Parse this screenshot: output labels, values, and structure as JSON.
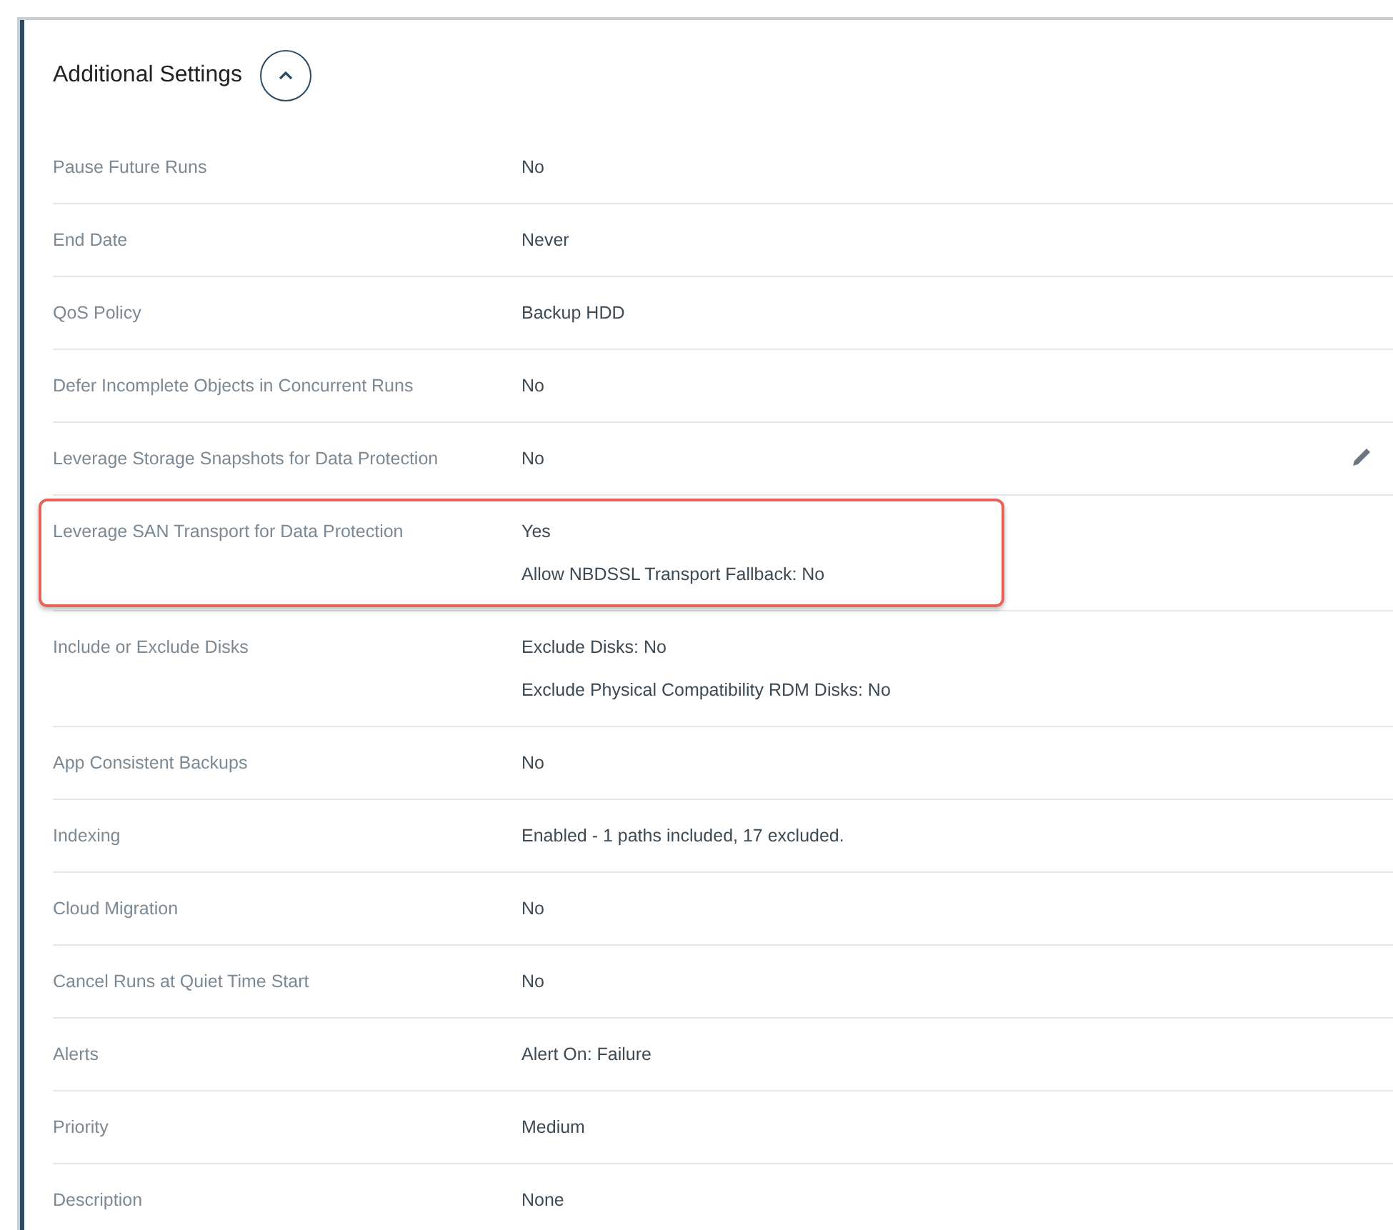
{
  "section": {
    "title": "Additional Settings",
    "expanded": true
  },
  "rows": [
    {
      "label": "Pause Future Runs",
      "values": [
        "No"
      ],
      "highlighted": false,
      "editable": false
    },
    {
      "label": "End Date",
      "values": [
        "Never"
      ],
      "highlighted": false,
      "editable": false
    },
    {
      "label": "QoS Policy",
      "values": [
        "Backup HDD"
      ],
      "highlighted": false,
      "editable": false
    },
    {
      "label": "Defer Incomplete Objects in Concurrent Runs",
      "values": [
        "No"
      ],
      "highlighted": false,
      "editable": false
    },
    {
      "label": "Leverage Storage Snapshots for Data Protection",
      "values": [
        "No"
      ],
      "highlighted": false,
      "editable": true
    },
    {
      "label": "Leverage SAN Transport for Data Protection",
      "values": [
        "Yes",
        "Allow NBDSSL Transport Fallback: No"
      ],
      "highlighted": true,
      "editable": false
    },
    {
      "label": "Include or Exclude Disks",
      "values": [
        "Exclude Disks: No",
        "Exclude Physical Compatibility RDM Disks: No"
      ],
      "highlighted": false,
      "editable": false
    },
    {
      "label": "App Consistent Backups",
      "values": [
        "No"
      ],
      "highlighted": false,
      "editable": false
    },
    {
      "label": "Indexing",
      "values": [
        "Enabled - 1 paths included, 17 excluded."
      ],
      "highlighted": false,
      "editable": false
    },
    {
      "label": "Cloud Migration",
      "values": [
        "No"
      ],
      "highlighted": false,
      "editable": false
    },
    {
      "label": "Cancel Runs at Quiet Time Start",
      "values": [
        "No"
      ],
      "highlighted": false,
      "editable": false
    },
    {
      "label": "Alerts",
      "values": [
        "Alert On: Failure"
      ],
      "highlighted": false,
      "editable": false
    },
    {
      "label": "Priority",
      "values": [
        "Medium"
      ],
      "highlighted": false,
      "editable": false
    },
    {
      "label": "Description",
      "values": [
        "None"
      ],
      "highlighted": false,
      "editable": false
    }
  ]
}
